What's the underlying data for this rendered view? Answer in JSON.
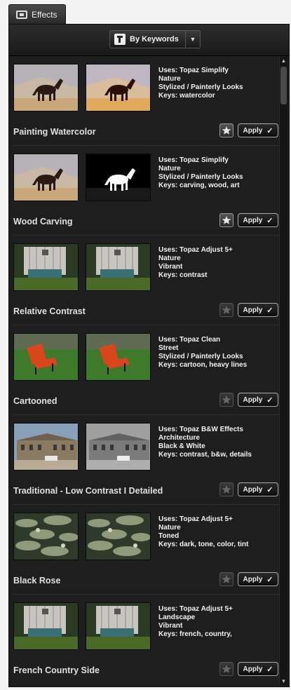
{
  "tab": {
    "label": "Effects"
  },
  "filter": {
    "selected": "By Keywords"
  },
  "effects": [
    {
      "title": "Painting Watercolor",
      "uses": "Uses: Topaz Simplify",
      "category": "Nature",
      "style": "Stylized / Painterly Looks",
      "keys": "Keys: watercolor",
      "favorite": true,
      "apply_label": "Apply",
      "scene": "horse",
      "after": "paint"
    },
    {
      "title": "Wood Carving",
      "uses": "Uses: Topaz Simplify",
      "category": "Nature",
      "style": "Stylized / Painterly Looks",
      "keys": "Keys: carving, wood, art",
      "favorite": true,
      "apply_label": "Apply",
      "scene": "horse",
      "after": "sketch"
    },
    {
      "title": "Relative Contrast",
      "uses": "Uses: Topaz Adjust 5+",
      "category": "Nature",
      "style": "Vibrant",
      "keys": "Keys: contrast",
      "favorite": false,
      "apply_label": "Apply",
      "scene": "barn",
      "after": "same"
    },
    {
      "title": "Cartooned",
      "uses": "Uses: Topaz Clean",
      "category": "Street",
      "style": "Stylized / Painterly Looks",
      "keys": "Keys: cartoon, heavy lines",
      "favorite": false,
      "apply_label": "Apply",
      "scene": "chair",
      "after": "same"
    },
    {
      "title": "Traditional - Low Contrast I Detailed",
      "uses": "Uses: Topaz B&W Effects",
      "category": "Architecture",
      "style": "Black & White",
      "keys": "Keys: contrast, b&w, details",
      "favorite": false,
      "apply_label": "Apply",
      "scene": "building",
      "after": "bw"
    },
    {
      "title": "Black Rose",
      "uses": "Uses: Topaz Adjust 5+",
      "category": "Nature",
      "style": "Toned",
      "keys": "Keys: dark, tone, color, tint",
      "favorite": false,
      "apply_label": "Apply",
      "scene": "lily",
      "after": "same"
    },
    {
      "title": "French Country Side",
      "uses": "Uses: Topaz Adjust 5+",
      "category": "Landscape",
      "style": "Vibrant",
      "keys": "Keys: french, country,",
      "favorite": false,
      "apply_label": "Apply",
      "scene": "barn",
      "after": "same"
    }
  ],
  "colors": {
    "panel": "#1e1e1e",
    "text": "#f2f2f2",
    "title": "#e0e0e0"
  }
}
